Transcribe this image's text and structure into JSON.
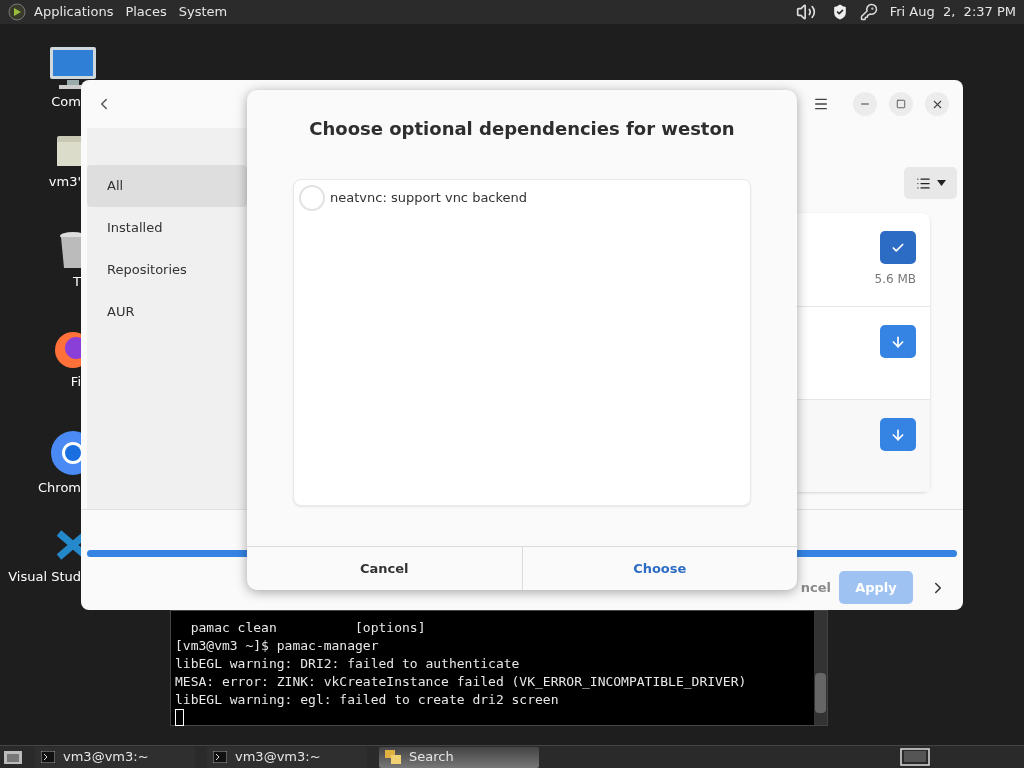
{
  "top_panel": {
    "menus": [
      "Applications",
      "Places",
      "System"
    ],
    "clock": "Fri Aug  2,  2:37 PM"
  },
  "desktop_icons": [
    {
      "kind": "monitor",
      "label": "Com"
    },
    {
      "kind": "home",
      "label": "vm3'"
    },
    {
      "kind": "trash",
      "label": "T"
    },
    {
      "kind": "firefox",
      "label": "Fi"
    },
    {
      "kind": "chrome",
      "label": "Chrom"
    },
    {
      "kind": "vscode",
      "label": "Visual Stud"
    }
  ],
  "terminal": {
    "lines": [
      "  pamac clean          [options]",
      "[vm3@vm3 ~]$ pamac-manager",
      "libEGL warning: DRI2: failed to authenticate",
      "MESA: error: ZINK: vkCreateInstance failed (VK_ERROR_INCOMPATIBLE_DRIVER)",
      "libEGL warning: egl: failed to create dri2 screen"
    ]
  },
  "package_manager": {
    "sidebar": {
      "items": [
        {
          "label": "All",
          "selected": true
        },
        {
          "label": "Installed",
          "selected": false
        },
        {
          "label": "Repositories",
          "selected": false
        },
        {
          "label": "AUR",
          "selected": false
        }
      ]
    },
    "packages": [
      {
        "installed": true,
        "size": "5.6 MB"
      },
      {
        "installed": false
      },
      {
        "installed": false
      }
    ],
    "progress": {
      "level": 1
    },
    "cancel": {
      "label": "ncel",
      "disabled": true
    },
    "apply": {
      "label": "Apply",
      "disabled": true
    }
  },
  "dialog": {
    "title": "Choose optional dependencies for weston",
    "options": [
      {
        "label": "neatvnc: support vnc backend",
        "checked": false
      }
    ],
    "buttons": [
      {
        "label": "Cancel",
        "kind": "cancel"
      },
      {
        "label": "Choose",
        "kind": "confirm"
      }
    ]
  },
  "taskbar": {
    "tasks": [
      {
        "label": "vm3@vm3:~",
        "kind": "terminal",
        "selected": false
      },
      {
        "label": "vm3@vm3:~",
        "kind": "terminal",
        "selected": false
      },
      {
        "label": "Search",
        "kind": "search",
        "selected": true
      }
    ]
  }
}
